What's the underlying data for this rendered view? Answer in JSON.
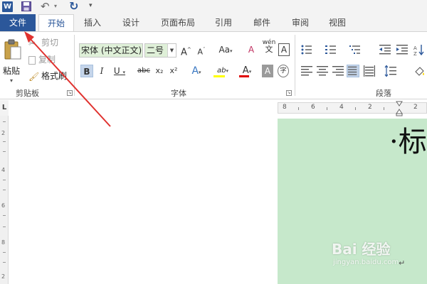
{
  "quick_access": {
    "app_icon_letter": "W",
    "icons": [
      "word-app-icon",
      "save-icon",
      "undo-icon",
      "undo-dropdown-icon",
      "redo-icon",
      "customize-qat-icon"
    ]
  },
  "tabs": [
    {
      "label": "文件"
    },
    {
      "label": "开始"
    },
    {
      "label": "插入"
    },
    {
      "label": "设计"
    },
    {
      "label": "页面布局"
    },
    {
      "label": "引用"
    },
    {
      "label": "邮件"
    },
    {
      "label": "审阅"
    },
    {
      "label": "视图"
    }
  ],
  "active_tab": "开始",
  "clipboard": {
    "group_label": "剪贴板",
    "paste_label": "粘贴",
    "cut_label": "剪切",
    "copy_label": "复制",
    "format_painter_label": "格式刷"
  },
  "font": {
    "group_label": "字体",
    "font_name": "宋体 (中文正文)",
    "font_size": "二号",
    "grow_label": "A",
    "shrink_label": "A",
    "change_case_label": "Aa",
    "clear_format_label": "A",
    "phonetic_label": "wén",
    "phonetic_char": "文",
    "char_border_label": "A",
    "bold_label": "B",
    "italic_label": "I",
    "underline_label": "U",
    "strikethrough_label": "abc",
    "subscript_label": "x₂",
    "superscript_label": "x²",
    "text_effect_label": "A",
    "highlight_label": "ab",
    "font_color_label": "A",
    "char_shading_label": "A",
    "enclose_label": "字"
  },
  "paragraph": {
    "group_label": "段落"
  },
  "document": {
    "ruler_corner": "L",
    "h_ruler_numbers": [
      "8",
      "6",
      "4",
      "2",
      "2"
    ],
    "v_ruler_numbers": [
      "2",
      "4",
      "6",
      "8",
      "2"
    ],
    "title_text": "·标",
    "paragraph_mark": "↵"
  },
  "watermark": {
    "main": "Bai 经验",
    "sub": "jingyan.baidu.com"
  },
  "colors": {
    "file_tab": "#2b579a",
    "page_background": "#c6e8cb",
    "highlight_yellow": "#ffff00",
    "font_color_red": "#e00000",
    "annotation_arrow": "#e0322f"
  }
}
